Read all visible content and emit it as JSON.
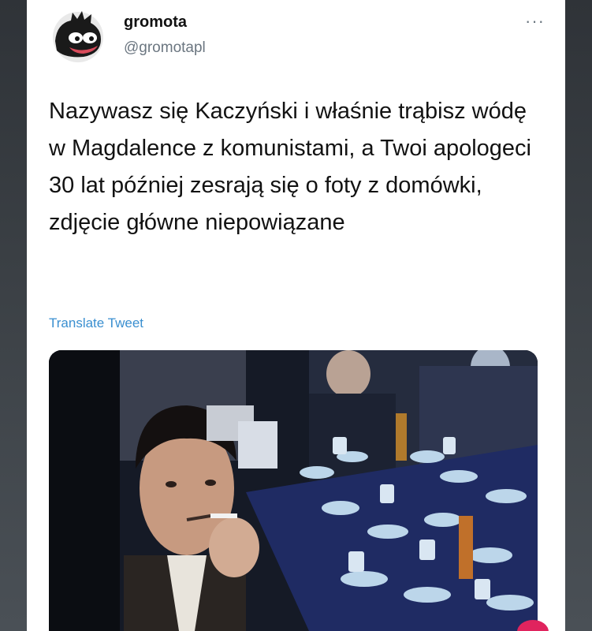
{
  "tweet": {
    "display_name": "gromota",
    "handle": "@gromotapl",
    "more_icon": "···",
    "text": "Nazywasz się Kaczyński i właśnie trąbisz wódę w Magdalence z komunistami, a Twoi apologeci 30 lat później zesrają się o foty z domówki, zdjęcie główne niepowiązane",
    "translate_label": "Translate Tweet"
  },
  "icons": {
    "avatar": "avatar-icon",
    "more": "more-options-icon",
    "media": "tweet-photo"
  },
  "colors": {
    "link": "#3a8fd0",
    "handle": "#6b7680",
    "text": "#121212",
    "background": "#2f3338"
  }
}
